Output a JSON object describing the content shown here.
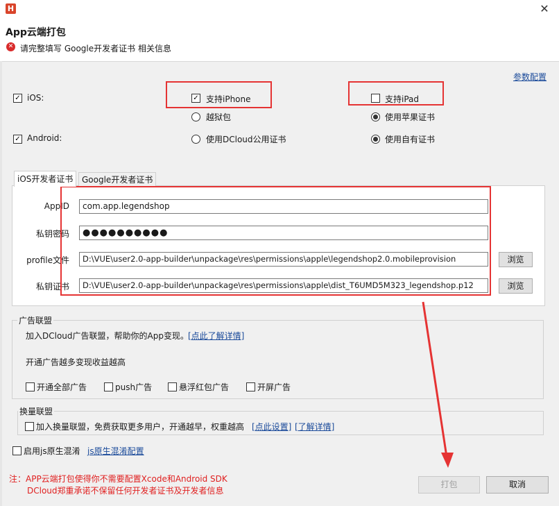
{
  "window": {
    "app_icon": "H",
    "close": "✕",
    "title": "App云端打包",
    "error_message": "请完整填写 Google开发者证书 相关信息"
  },
  "config_link": "参数配置",
  "platforms": {
    "ios_label": "iOS:",
    "android_label": "Android:",
    "support_iphone": "支持iPhone",
    "support_ipad": "支持iPad",
    "jailbreak": "越狱包",
    "use_apple_cert": "使用苹果证书",
    "use_dcloud_cert": "使用DCloud公用证书",
    "use_own_cert": "使用自有证书"
  },
  "tabs": [
    {
      "label": "iOS开发者证书",
      "active": true
    },
    {
      "label": "Google开发者证书",
      "active": false
    }
  ],
  "ios_cert": {
    "appid_label": "AppID",
    "appid_value": "com.app.legendshop",
    "password_label": "私钥密码",
    "password_value": "●●●●●●●●●●",
    "profile_label": "profile文件",
    "profile_value": "D:\\VUE\\user2.0-app-builder\\unpackage\\res\\permissions\\apple\\legendshop2.0.mobileprovision",
    "cert_label": "私钥证书",
    "cert_value": "D:\\VUE\\user2.0-app-builder\\unpackage\\res\\permissions\\apple\\dist_T6UMD5M323_legendshop.p12",
    "browse": "浏览"
  },
  "ad_union": {
    "title": "广告联盟",
    "join_text": "加入DCloud广告联盟，帮助你的App变现。",
    "details_link": "[点此了解详情]",
    "promo": "开通广告越多变现收益越高",
    "options": [
      "开通全部广告",
      "push广告",
      "悬浮红包广告",
      "开屏广告"
    ]
  },
  "exchange_union": {
    "title": "换量联盟",
    "join_text": "加入换量联盟，免费获取更多用户，开通越早，权重越高",
    "setup_link": "[点此设置]",
    "learn_link": "[了解详情]"
  },
  "obfuscation": {
    "label": "启用js原生混淆",
    "config_link": "js原生混淆配置"
  },
  "footer": {
    "note_line1": "注：APP云端打包使得你不需要配置Xcode和Android SDK",
    "note_line2": "DCloud郑重承诺不保留任何开发者证书及开发者信息",
    "pack_button": "打包",
    "cancel_button": "取消"
  },
  "colors": {
    "annotation_red": "#e53333",
    "link_blue": "#1a4a9a",
    "error_red": "#d92b2b"
  }
}
